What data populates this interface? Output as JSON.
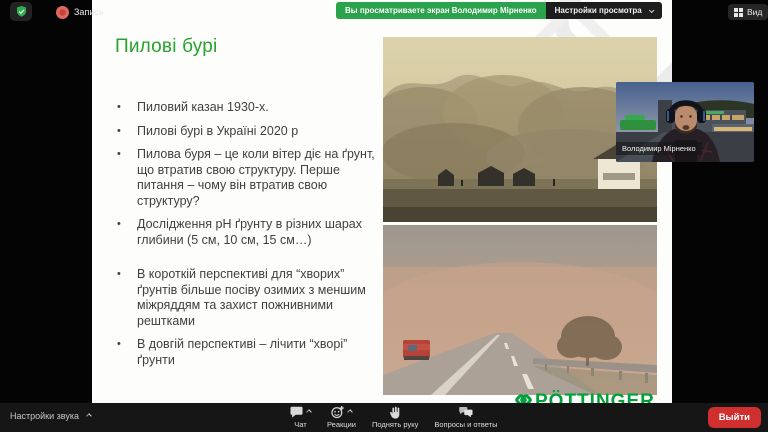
{
  "colors": {
    "share_banner_green": "#2ba24c",
    "title_green": "#27a22d",
    "logo_green": "#00a13a",
    "leave_red": "#d02f2f"
  },
  "top_bar": {
    "recording_label": "Запись",
    "share_banner": "Вы просматриваете экран Володимир Мірненко",
    "view_settings_label": "Настройки просмотра",
    "view_label": "Вид"
  },
  "slide": {
    "title": "Пилові бурі",
    "bullets": [
      "Пиловий казан 1930-х.",
      "Пилові бурі в Україні 2020 р",
      "Пилова буря – це коли вітер діє на ґрунт, що втратив свою структуру. Перше питання – чому він втратив свою структуру?",
      "Дослідження pH ґрунту в різних шарах глибини (5 см, 10 см, 15 см…)",
      "В короткій перспективі для “хворих” ґрунтів більше посіву озимих з меншим міжряддям та захист пожнивними рештками",
      "В довгій перспективі – лічити “хворі” ґрунти"
    ],
    "logo_text": "PÖTTINGER"
  },
  "webcam": {
    "participant_name": "Володимир Мірненко"
  },
  "bottom_bar": {
    "audio_settings_label": "Настройки звука",
    "chat_label": "Чат",
    "reactions_label": "Реакции",
    "raise_hand_label": "Поднять руку",
    "qa_label": "Вопросы и ответы",
    "leave_label": "Выйти"
  }
}
